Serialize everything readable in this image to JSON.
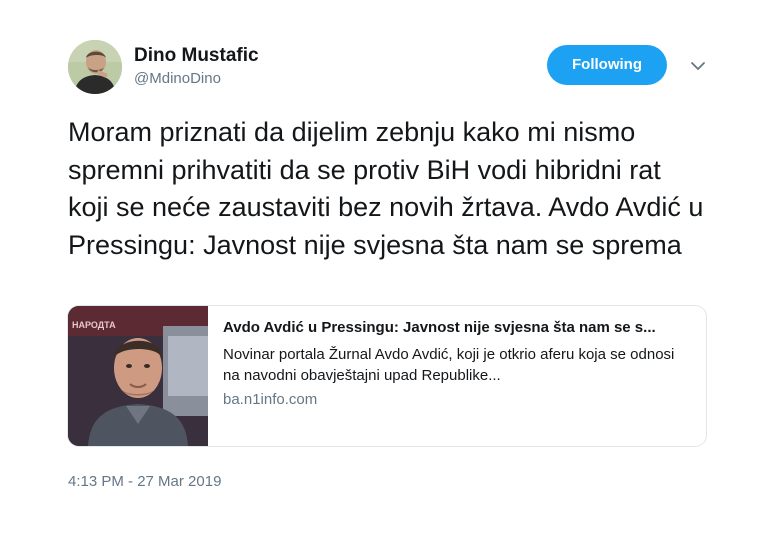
{
  "user": {
    "display_name": "Dino Mustafic",
    "handle": "@MdinoDino",
    "follow_label": "Following"
  },
  "tweet": {
    "text": "Moram priznati da dijelim zebnju kako mi nismo spremni prihvatiti da se protiv BiH vodi hibridni rat koji se neće zaustaviti bez novih žrtava. Avdo Avdić u Pressingu: Javnost nije svjesna šta nam se sprema",
    "timestamp": "4:13 PM - 27 Mar 2019"
  },
  "card": {
    "title": "Avdo Avdić u Pressingu: Javnost nije svjesna šta nam se s...",
    "description": "Novinar portala Žurnal Avdo Avdić, koji je otkrio aferu koja se odnosi na navodni obavještajni upad Republike...",
    "domain": "ba.n1info.com",
    "image_caption_fragment": "HАРОДТА"
  },
  "colors": {
    "accent": "#1da1f2",
    "text": "#14171a",
    "muted": "#657786",
    "border": "#e1e8ed"
  },
  "icons": {
    "caret": "chevron-down-icon"
  }
}
